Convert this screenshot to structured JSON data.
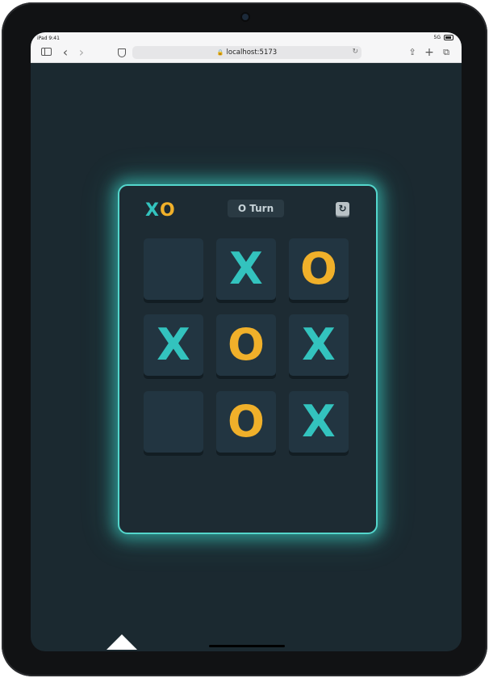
{
  "status_bar": {
    "time": "iPad 9:41",
    "network": "5G"
  },
  "browser": {
    "url": "localhost:5173",
    "icons": [
      "sidebar-icon",
      "back-icon",
      "forward-icon",
      "shield-icon",
      "lock-icon",
      "reload-icon",
      "share-icon",
      "new-tab-icon",
      "tabs-icon"
    ],
    "back_glyph": "‹",
    "forward_glyph": "›",
    "reload_glyph": "↻",
    "lock_glyph": "🔒",
    "share_glyph": "⇪",
    "new_tab_glyph": "+",
    "tabs_glyph": "⧉"
  },
  "game": {
    "logo_x": "X",
    "logo_o": "O",
    "turn_label": "O Turn",
    "restart_glyph": "↻",
    "colors": {
      "x": "#33c3be",
      "o": "#f0b02a",
      "accent": "#54d6cc",
      "background": "#1b2930"
    },
    "board": [
      [
        "",
        "X",
        "O"
      ],
      [
        "X",
        "O",
        "X"
      ],
      [
        "",
        "O",
        "X"
      ]
    ]
  }
}
